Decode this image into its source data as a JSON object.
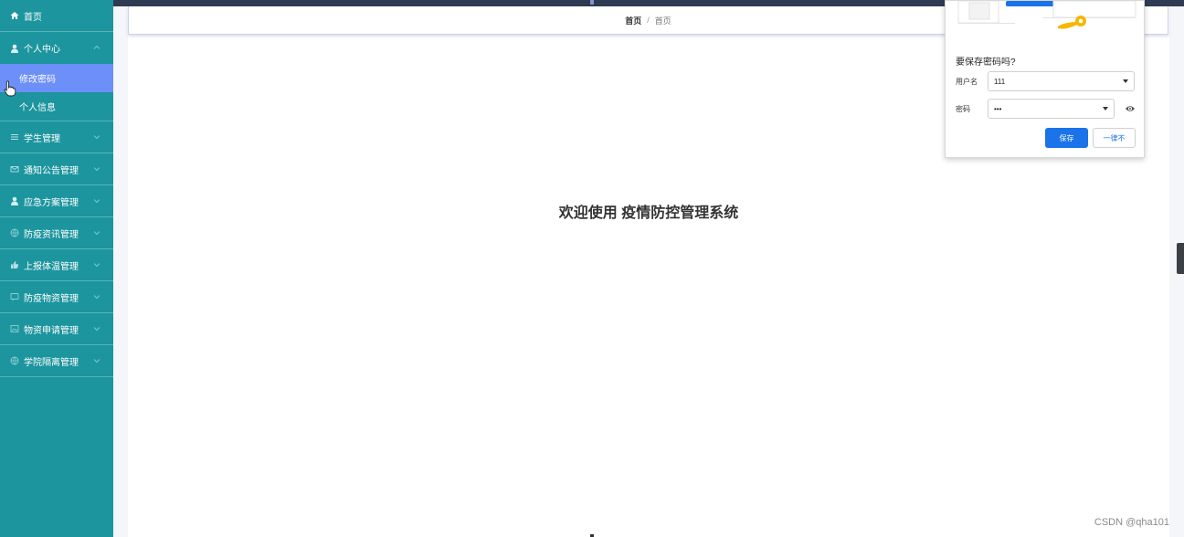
{
  "sidebar": {
    "home": {
      "label": "首页",
      "icon": "home-icon"
    },
    "personal_center": {
      "label": "个人中心",
      "icon": "user-icon"
    },
    "sub_items": [
      {
        "label": "修改密码",
        "active": true
      },
      {
        "label": "个人信息",
        "active": false
      }
    ],
    "items": [
      {
        "label": "学生管理",
        "icon": "list-icon"
      },
      {
        "label": "通知公告管理",
        "icon": "mail-icon"
      },
      {
        "label": "应急方案管理",
        "icon": "user-icon"
      },
      {
        "label": "防疫资讯管理",
        "icon": "globe-icon"
      },
      {
        "label": "上报体温管理",
        "icon": "thumb-icon"
      },
      {
        "label": "防疫物资管理",
        "icon": "chat-icon"
      },
      {
        "label": "物资申请管理",
        "icon": "image-icon"
      },
      {
        "label": "学院隔离管理",
        "icon": "globe-icon"
      }
    ]
  },
  "breadcrumb": {
    "root": "首页",
    "separator": "/",
    "current": "首页"
  },
  "main": {
    "welcome": "欢迎使用 疫情防控管理系统"
  },
  "password_popup": {
    "title": "要保存密码吗?",
    "username_label": "用户名",
    "username_value": "111",
    "password_label": "密码",
    "password_value": "•••",
    "save_label": "保存",
    "never_label": "一律不"
  },
  "watermark": "CSDN @qha101",
  "colors": {
    "sidebar": "#1c959e",
    "active": "#6d8ff8",
    "primary": "#1a73e8"
  }
}
